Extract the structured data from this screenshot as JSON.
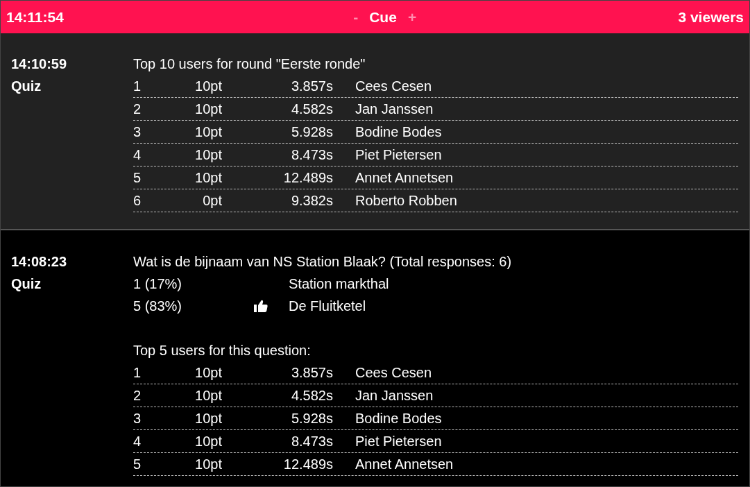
{
  "header": {
    "clock": "14:11:54",
    "minus": "-",
    "title": "Cue",
    "plus": "+",
    "viewers": "3 viewers"
  },
  "entries": [
    {
      "kind": "ranking",
      "time": "14:10:59",
      "type": "Quiz",
      "title": "Top 10 users for round \"Eerste ronde\"",
      "rows": [
        {
          "rank": "1",
          "points": "10pt",
          "duration": "3.857s",
          "name": "Cees Cesen"
        },
        {
          "rank": "2",
          "points": "10pt",
          "duration": "4.582s",
          "name": "Jan Janssen"
        },
        {
          "rank": "3",
          "points": "10pt",
          "duration": "5.928s",
          "name": "Bodine Bodes"
        },
        {
          "rank": "4",
          "points": "10pt",
          "duration": "8.473s",
          "name": "Piet Pietersen"
        },
        {
          "rank": "5",
          "points": "10pt",
          "duration": "12.489s",
          "name": "Annet Annetsen"
        },
        {
          "rank": "6",
          "points": "0pt",
          "duration": "9.382s",
          "name": "Roberto Robben"
        }
      ]
    },
    {
      "kind": "question",
      "time": "14:08:23",
      "type": "Quiz",
      "title": "Wat is de bijnaam van NS Station Blaak? (Total responses: 6)",
      "answers": [
        {
          "count": "1 (17%)",
          "correct": false,
          "text": "Station markthal"
        },
        {
          "count": "5 (83%)",
          "correct": true,
          "text": "De Fluitketel"
        }
      ],
      "ranking_title": "Top 5 users for this question:",
      "rows": [
        {
          "rank": "1",
          "points": "10pt",
          "duration": "3.857s",
          "name": "Cees Cesen"
        },
        {
          "rank": "2",
          "points": "10pt",
          "duration": "4.582s",
          "name": "Jan Janssen"
        },
        {
          "rank": "3",
          "points": "10pt",
          "duration": "5.928s",
          "name": "Bodine Bodes"
        },
        {
          "rank": "4",
          "points": "10pt",
          "duration": "8.473s",
          "name": "Piet Pietersen"
        },
        {
          "rank": "5",
          "points": "10pt",
          "duration": "12.489s",
          "name": "Annet Annetsen"
        }
      ]
    }
  ]
}
